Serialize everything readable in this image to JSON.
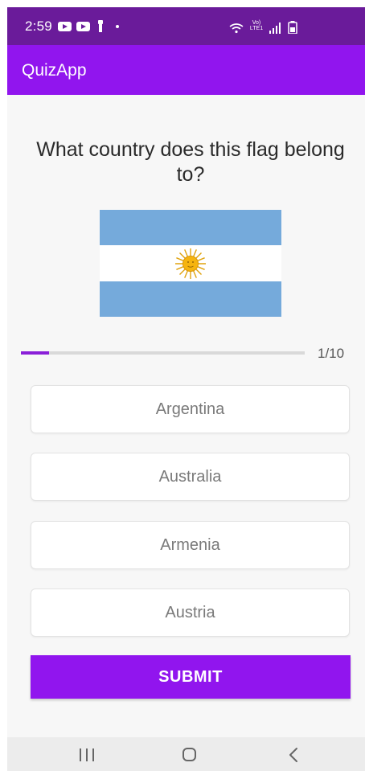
{
  "status_bar": {
    "time": "2:59",
    "network_label": "Vo) LTE1",
    "icons": [
      "youtube-icon",
      "youtube-icon",
      "flashlight-icon",
      "notification-dot-icon",
      "wifi-icon",
      "signal-icon",
      "battery-saver-icon"
    ]
  },
  "app_bar": {
    "title": "QuizApp"
  },
  "quiz": {
    "question": "What country does this flag belong to?",
    "flag_icon": "argentina-flag",
    "progress": {
      "current": 1,
      "total": 10,
      "label": "1/10"
    },
    "options": [
      {
        "label": "Argentina"
      },
      {
        "label": "Australia"
      },
      {
        "label": "Armenia"
      },
      {
        "label": "Austria"
      }
    ],
    "submit_label": "SUBMIT"
  },
  "nav_bar": {
    "icons": [
      "recent-apps-icon",
      "home-icon",
      "back-icon"
    ]
  },
  "colors": {
    "status_bar": "#6a1b9a",
    "accent": "#9115ee",
    "flag_blue": "#75aadb",
    "flag_sun": "#f6b40e"
  }
}
